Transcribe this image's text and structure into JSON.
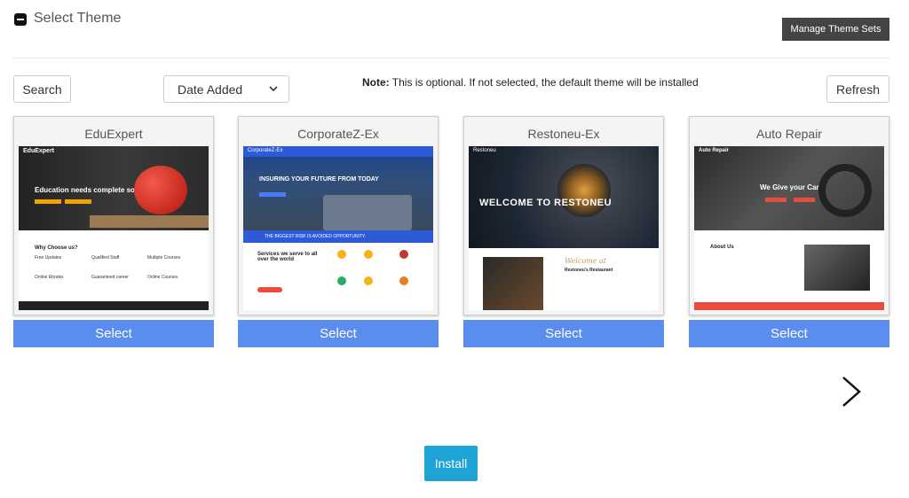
{
  "header": {
    "title": "Select Theme",
    "manage_label": "Manage Theme Sets"
  },
  "toolbar": {
    "search_label": "Search",
    "sort_selected": "Date Added",
    "note_bold": "Note:",
    "note_text": " This is optional. If not selected, the default theme will be installed",
    "refresh_label": "Refresh"
  },
  "themes": [
    {
      "name": "EduExpert",
      "select_label": "Select",
      "brand": "EduExpert",
      "headline": "Education needs complete solving",
      "section": "Why Choose us?",
      "features": [
        "Free Updates",
        "Qualified Staff",
        "Multiple Courses",
        "Online Ebooks",
        "Guaranteed career",
        "Online Courses"
      ]
    },
    {
      "name": "CorporateZ-Ex",
      "select_label": "Select",
      "brand": "CorporateZ-Ex",
      "headline": "INSURING YOUR FUTURE FROM TODAY",
      "banner": "THE BIGGEST RISK IS AVOIDED OPPORTUNITY.",
      "section": "Services we serve to all over the world"
    },
    {
      "name": "Restoneu-Ex",
      "select_label": "Select",
      "brand": "Restoneu",
      "headline": "WELCOME TO RESTONEU",
      "script_title": "Welcome at",
      "section": "Restoneu's Restaurant"
    },
    {
      "name": "Auto Repair",
      "select_label": "Select",
      "brand": "Auto Repair",
      "headline": "We Give your Car",
      "section": "About Us"
    }
  ],
  "footer": {
    "install_label": "Install"
  },
  "colors": {
    "select_button": "#5b8def",
    "install_button": "#1ea3d6",
    "manage_button": "#444444"
  },
  "icons": {
    "collapse": "minus-square-icon",
    "sort": "chevron-down-icon",
    "next": "chevron-right-icon"
  }
}
